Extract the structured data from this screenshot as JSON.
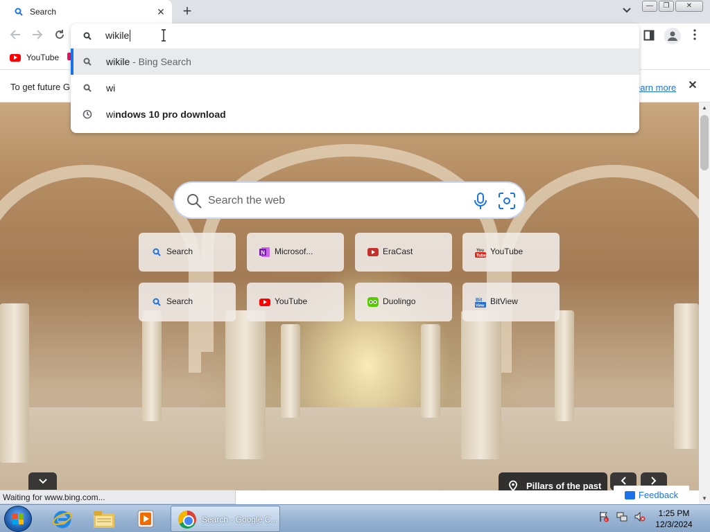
{
  "browser": {
    "tab": {
      "title": "Search",
      "close": "✕"
    },
    "new_tab": "+",
    "window_buttons": {
      "minimize": "—",
      "maximize": "❐",
      "close": "✕"
    },
    "omnibox": {
      "input_value": "wikile",
      "suggestions": [
        {
          "prefix": "wikile",
          "suffix": " - Bing Search",
          "bold": "",
          "icon": "search-icon",
          "selected": true
        },
        {
          "prefix": "wi",
          "suffix": "",
          "bold": "",
          "icon": "search-icon",
          "selected": false
        },
        {
          "prefix": "wi",
          "suffix": "",
          "bold": "ndows 10 pro download",
          "icon": "history-icon",
          "selected": false
        }
      ]
    },
    "bookmarks": [
      {
        "label": "YouTube",
        "icon": "youtube-icon"
      }
    ],
    "infobar": {
      "text": "To get future G",
      "link": "earn more",
      "close": "✕"
    },
    "status_text": "Waiting for www.bing.com..."
  },
  "ntp": {
    "search_placeholder": "Search the web",
    "tiles": [
      {
        "label": "Search",
        "icon": "search-icon"
      },
      {
        "label": "Microsof...",
        "icon": "onenote-icon"
      },
      {
        "label": "EraCast",
        "icon": "eracast-icon"
      },
      {
        "label": "YouTube",
        "icon": "youtube-old-icon"
      },
      {
        "label": "Search",
        "icon": "search-icon"
      },
      {
        "label": "YouTube",
        "icon": "youtube-icon"
      },
      {
        "label": "Duolingo",
        "icon": "duolingo-icon"
      },
      {
        "label": "BitView",
        "icon": "bitview-icon"
      }
    ],
    "attribution": "Pillars of the past",
    "feedback": "Feedback"
  },
  "taskbar": {
    "active_app_label": "Search - Google C...",
    "clock_time": "1:25 PM",
    "clock_date": "12/3/2024"
  },
  "colors": {
    "accent": "#1a73e8",
    "youtube_red": "#ff0000",
    "duolingo_green": "#58cc02",
    "onenote_purple": "#7719aa"
  }
}
